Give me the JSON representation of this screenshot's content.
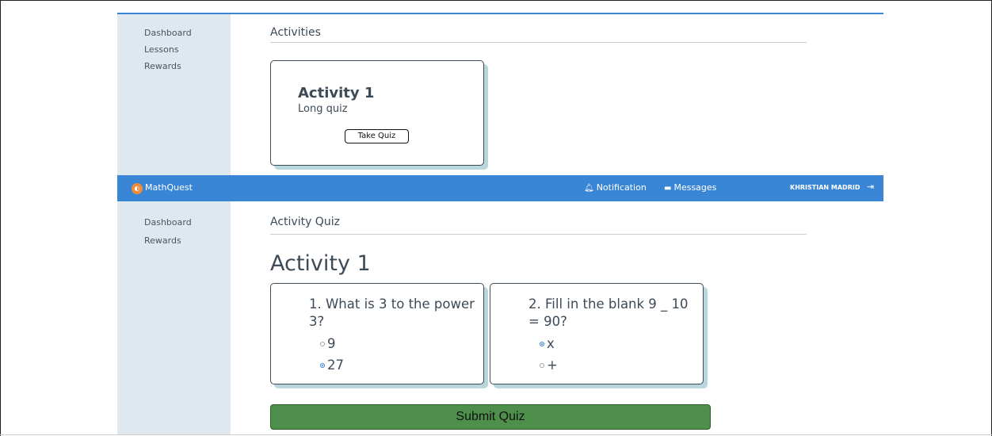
{
  "top_sidebar": {
    "items": [
      {
        "label": "Dashboard"
      },
      {
        "label": "Lessons"
      },
      {
        "label": "Rewards"
      }
    ]
  },
  "activities_section": {
    "title": "Activities",
    "card": {
      "title": "Activity 1",
      "subtitle": "Long quiz",
      "button_label": "Take Quiz"
    }
  },
  "navbar": {
    "logo_glyph": "◐",
    "brand": "MathQuest",
    "notification_label": "Notification",
    "notification_icon": "bell-icon",
    "messages_label": "Messages",
    "messages_icon": "chat-icon",
    "user_name": "KHRISTIAN MADRID",
    "logout_icon": "logout-icon",
    "color": "#3a86d6"
  },
  "bottom_sidebar": {
    "items": [
      {
        "label": "Dashboard"
      },
      {
        "label": "Rewards"
      }
    ]
  },
  "quiz_section": {
    "title": "Activity Quiz",
    "heading": "Activity 1",
    "questions": [
      {
        "text": "1. What is 3 to the power 3?",
        "options": [
          {
            "label": "9",
            "selected": false
          },
          {
            "label": "27",
            "selected": true
          }
        ]
      },
      {
        "text": "2. Fill in the blank 9 _ 10 = 90?",
        "options": [
          {
            "label": "x",
            "selected": true
          },
          {
            "label": "+",
            "selected": false
          }
        ]
      }
    ],
    "submit_label": "Submit Quiz",
    "submit_color": "#4e8f4c"
  }
}
